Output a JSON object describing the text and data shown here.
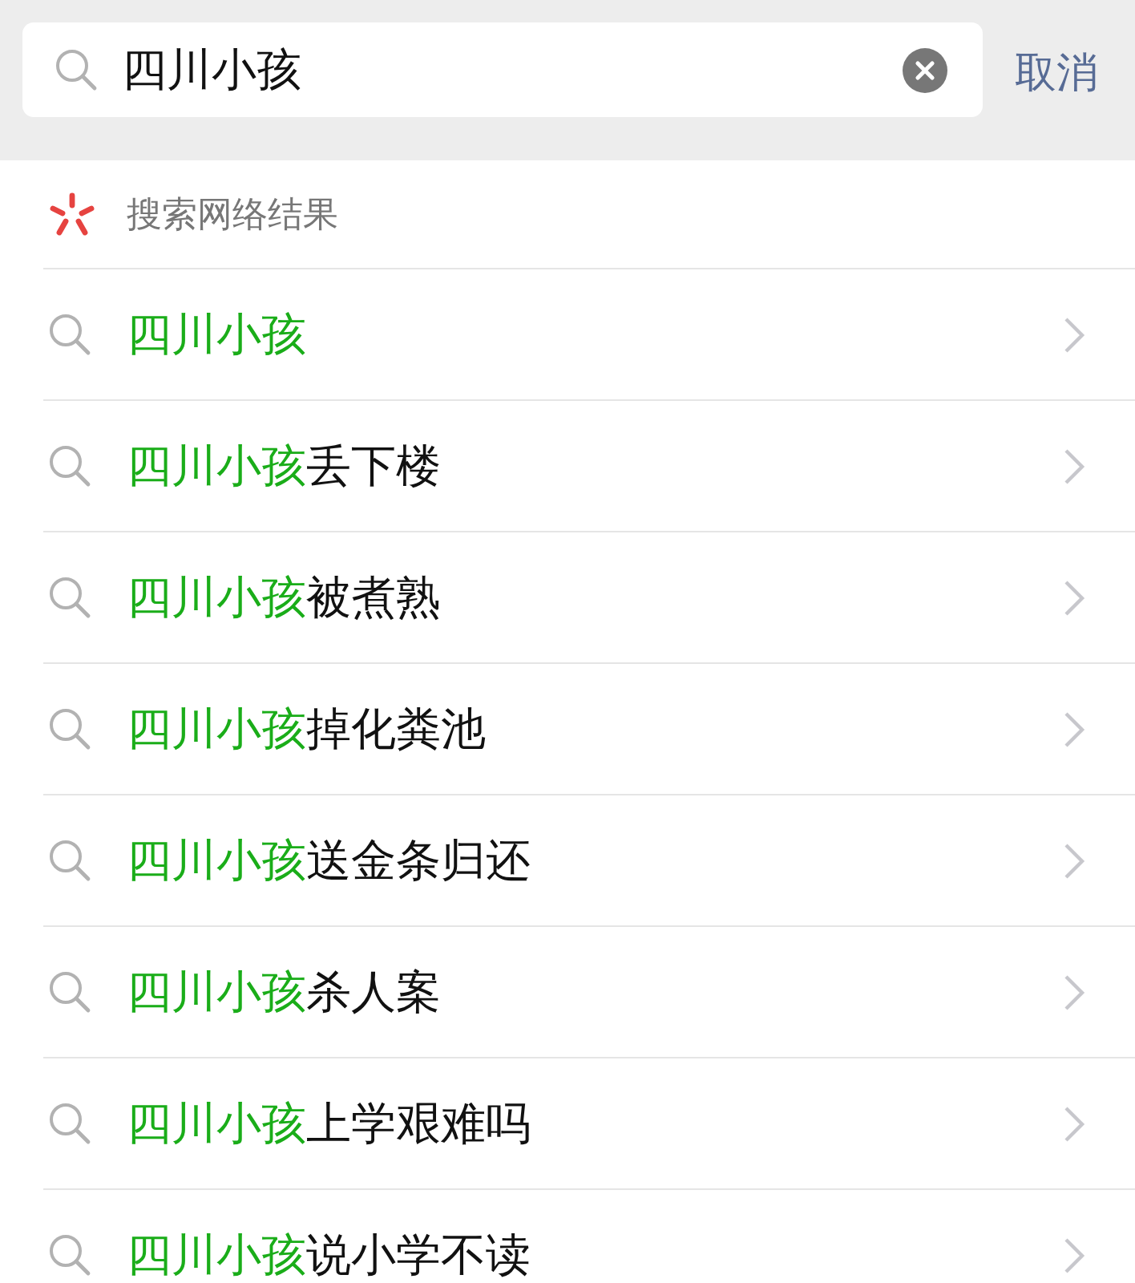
{
  "search": {
    "value": "四川小孩",
    "cancel": "取消"
  },
  "section": {
    "title": "搜索网络结果"
  },
  "suggestions": [
    {
      "match": "四川小孩"
    },
    {
      "match": "四川小孩",
      "rest": "丢下楼"
    },
    {
      "match": "四川小孩",
      "rest": "被煮熟"
    },
    {
      "match": "四川小孩",
      "rest": "掉化粪池"
    },
    {
      "match": "四川小孩",
      "rest": "送金条归还"
    },
    {
      "match": "四川小孩",
      "rest": "杀人案"
    },
    {
      "match": "四川小孩",
      "rest": "上学艰难吗"
    },
    {
      "match": "四川小孩",
      "rest": "说小学不读"
    }
  ]
}
